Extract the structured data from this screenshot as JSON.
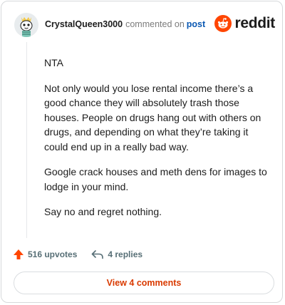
{
  "header": {
    "username": "CrystalQueen3000",
    "meta": "commented on",
    "post_link": "post",
    "brand": "reddit"
  },
  "comment": {
    "paragraphs": [
      "NTA",
      "Not only would you lose rental income there’s a good chance they will absolutely trash those houses. People on drugs hang out with others on drugs, and depending on what they’re taking it could end up in a really bad way.",
      "Google crack houses and meth dens for images to lodge in your mind.",
      "Say no and regret nothing."
    ]
  },
  "actions": {
    "upvotes": "516 upvotes",
    "replies": "4 replies"
  },
  "view_button": "View 4 comments",
  "colors": {
    "accent": "#ff4500",
    "link": "#0b59b3",
    "view_text": "#d93a00",
    "muted": "#576f76"
  },
  "icons": [
    "avatar",
    "reddit-logo-icon",
    "upvote-arrow-icon",
    "reply-arrow-icon"
  ]
}
